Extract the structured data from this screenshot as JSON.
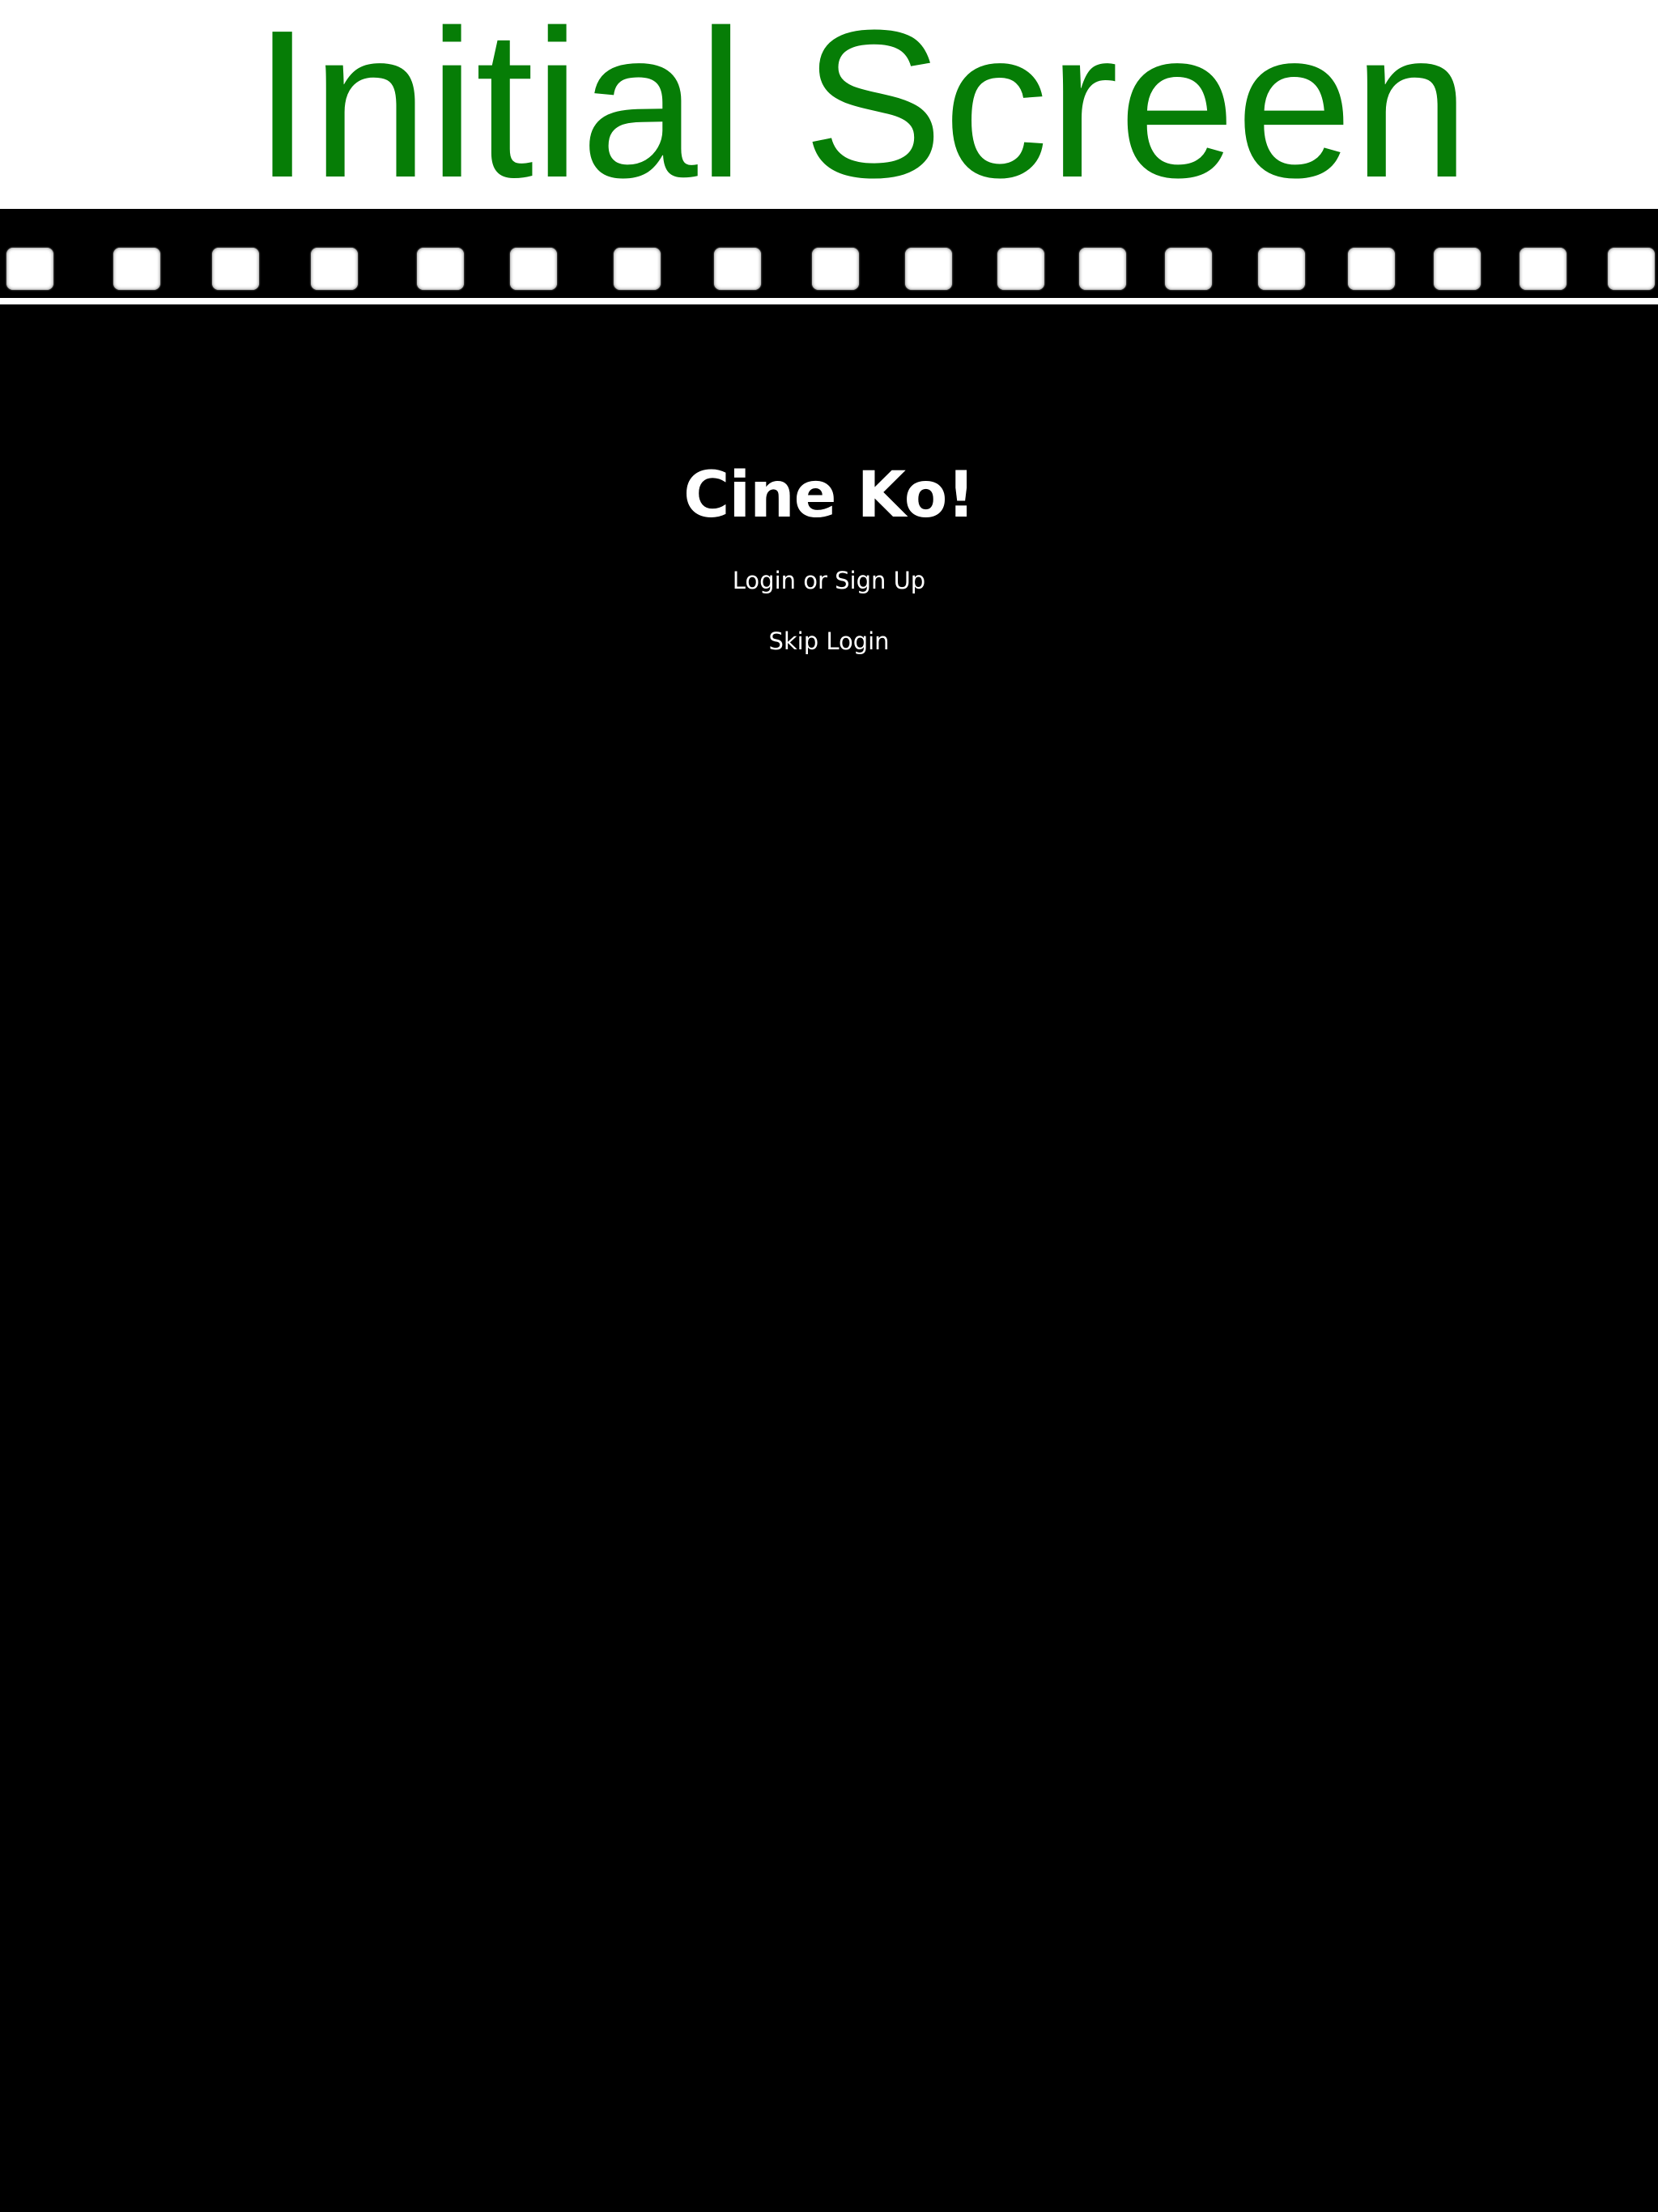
{
  "header": {
    "title": "Initial Screen",
    "title_color": "#067d06"
  },
  "filmstrip": {
    "icon": "filmstrip-sprocket-holes"
  },
  "main": {
    "app_name": "Cine Ko!",
    "login_label": "Login or Sign Up",
    "skip_label": "Skip Login"
  }
}
